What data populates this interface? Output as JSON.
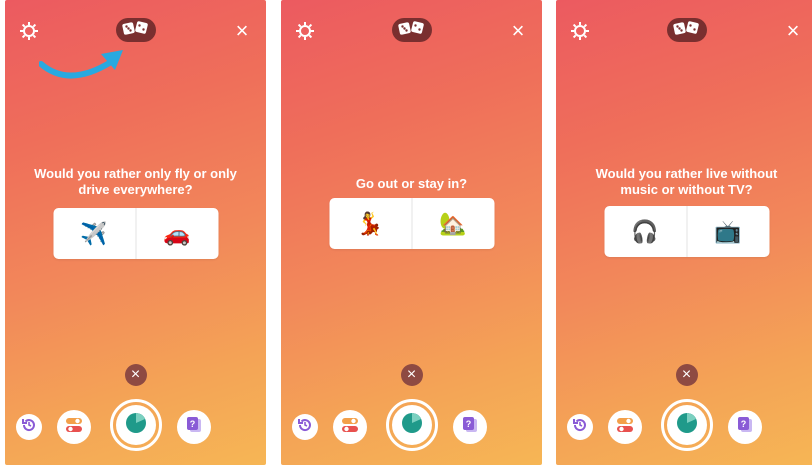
{
  "colors": {
    "gradient_top": "#ec5a60",
    "gradient_bottom": "#f6b655",
    "dice_pill": "#7a2f2f",
    "annotation_arrow": "#29a9e0",
    "chart_teal": "#1f9a8a"
  },
  "icons": {
    "settings": "gear-icon",
    "close": "close-icon",
    "random": "dice-icon",
    "dismiss": "close-icon",
    "history": "history-icon",
    "toggle": "toggles-icon",
    "capture": "pie-chart-icon",
    "question": "question-card-icon"
  },
  "glyphs": {
    "close": "×",
    "dismiss": "×"
  },
  "panels": [
    {
      "question": "Would you rather only fly or only drive everywhere?",
      "options": [
        {
          "emoji": "✈️",
          "name": "airplane"
        },
        {
          "emoji": "🚗",
          "name": "car"
        }
      ],
      "has_arrow": true
    },
    {
      "question": "Go out or stay in?",
      "options": [
        {
          "emoji": "💃",
          "name": "dancer"
        },
        {
          "emoji": "🏡",
          "name": "house"
        }
      ],
      "has_arrow": false
    },
    {
      "question": "Would you rather live without music or without TV?",
      "options": [
        {
          "emoji": "🎧",
          "name": "headphones"
        },
        {
          "emoji": "📺",
          "name": "tv"
        }
      ],
      "has_arrow": false
    }
  ]
}
